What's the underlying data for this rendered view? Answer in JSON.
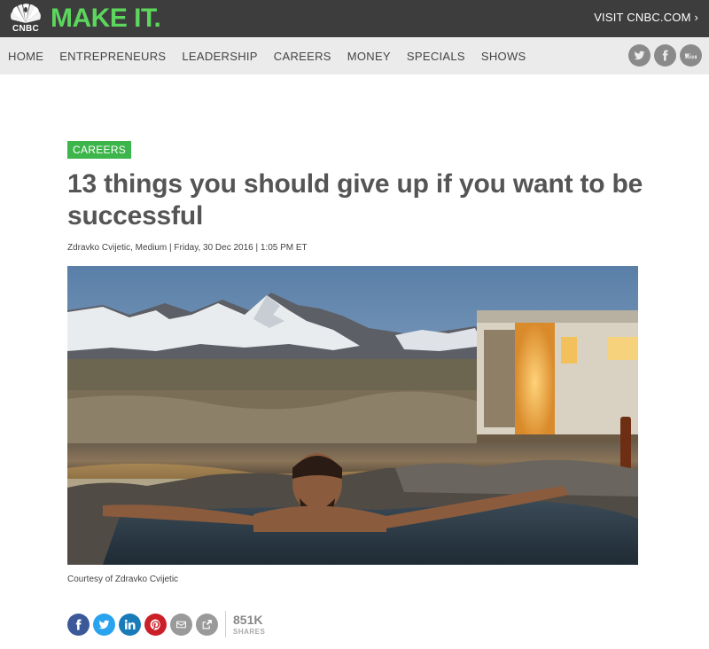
{
  "header": {
    "brand_small": "CNBC",
    "brand_main": "MAKE IT.",
    "visit_link": "VISIT CNBC.COM ›",
    "colors": {
      "bar": "#3d3d3d",
      "brand_green": "#5cd65c"
    }
  },
  "nav": {
    "items": [
      {
        "label": "HOME"
      },
      {
        "label": "ENTREPRENEURS"
      },
      {
        "label": "LEADERSHIP"
      },
      {
        "label": "CAREERS"
      },
      {
        "label": "MONEY"
      },
      {
        "label": "SPECIALS"
      },
      {
        "label": "SHOWS"
      }
    ],
    "social": [
      {
        "icon": "twitter-icon"
      },
      {
        "icon": "facebook-icon"
      },
      {
        "icon": "youtube-icon"
      }
    ]
  },
  "article": {
    "tag": "CAREERS",
    "headline": "13 things you should give up if you want to be successful",
    "byline": "Zdravko Cvijetic, Medium | Friday, 30 Dec 2016 | 1:05 PM ET",
    "caption": "Courtesy of Zdravko Cvijetic"
  },
  "share": {
    "buttons": [
      {
        "icon": "facebook-icon",
        "color": "#3b5998"
      },
      {
        "icon": "twitter-icon",
        "color": "#2aa3ef"
      },
      {
        "icon": "linkedin-icon",
        "color": "#1a7bb9"
      },
      {
        "icon": "pinterest-icon",
        "color": "#cb2027"
      },
      {
        "icon": "email-icon",
        "color": "#9a9a9a"
      },
      {
        "icon": "share-icon",
        "color": "#9a9a9a"
      }
    ],
    "count": "851K",
    "count_label": "SHARES"
  }
}
